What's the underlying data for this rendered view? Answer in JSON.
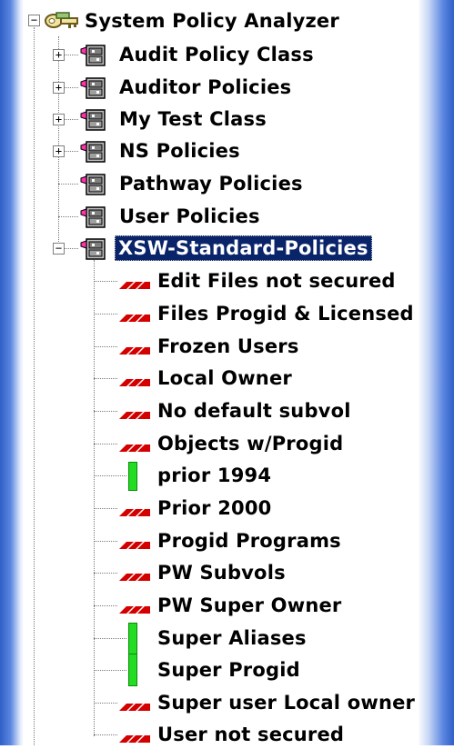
{
  "tree": {
    "root_label": "System Policy Analyzer",
    "classes": [
      {
        "label": "Audit Policy Class",
        "expander": "+"
      },
      {
        "label": "Auditor Policies",
        "expander": "+"
      },
      {
        "label": "My Test Class",
        "expander": "+"
      },
      {
        "label": "NS Policies",
        "expander": "+"
      },
      {
        "label": "Pathway Policies",
        "expander": ""
      },
      {
        "label": "User Policies",
        "expander": ""
      },
      {
        "label": "XSW-Standard-Policies",
        "expander": "−",
        "selected": true
      }
    ],
    "policies": [
      {
        "label": "Edit Files not secured",
        "icon": "red-rule-icon"
      },
      {
        "label": "Files Progid & Licensed",
        "icon": "red-rule-icon"
      },
      {
        "label": "Frozen Users",
        "icon": "red-rule-icon"
      },
      {
        "label": "Local Owner",
        "icon": "red-rule-icon"
      },
      {
        "label": "No default subvol",
        "icon": "red-rule-icon"
      },
      {
        "label": "Objects w/Progid",
        "icon": "red-rule-icon"
      },
      {
        "label": "prior 1994",
        "icon": "green-rule-icon"
      },
      {
        "label": "Prior 2000",
        "icon": "red-rule-icon"
      },
      {
        "label": "Progid Programs",
        "icon": "red-rule-icon"
      },
      {
        "label": "PW Subvols",
        "icon": "red-rule-icon"
      },
      {
        "label": "PW Super Owner",
        "icon": "red-rule-icon"
      },
      {
        "label": "Super Aliases",
        "icon": "green-rule-icon"
      },
      {
        "label": "Super Progid",
        "icon": "green-rule-icon"
      },
      {
        "label": "Super user Local owner",
        "icon": "red-rule-icon"
      },
      {
        "label": "User not secured",
        "icon": "red-rule-icon"
      }
    ]
  },
  "colors": {
    "selection_bg": "#0a246a",
    "rule_red": "#d40000",
    "rule_green": "#22dd22",
    "edge_blue": "#2f5fc8"
  }
}
